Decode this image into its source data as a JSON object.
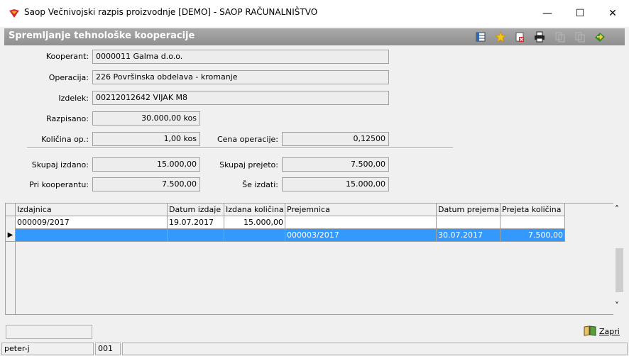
{
  "window": {
    "title": "Saop Večnivojski razpis proizvodnje [DEMO] - SAOP RAČUNALNIŠTVO",
    "minimize_glyph": "—",
    "maximize_glyph": "☐",
    "close_glyph": "✕"
  },
  "header": {
    "title": "Spremljanje tehnološke kooperacije",
    "toolbar_icons": [
      "columns-icon",
      "star-icon",
      "delete-doc-icon",
      "print-icon",
      "copy-disabled-icon",
      "copy2-disabled-icon",
      "exit-icon"
    ]
  },
  "form": {
    "kooperant_label": "Kooperant:",
    "kooperant_value": "0000011 Galma d.o.o.",
    "operacija_label": "Operacija:",
    "operacija_value": "226 Površinska obdelava - kromanje",
    "izdelek_label": "Izdelek:",
    "izdelek_value": "00212012642 VIJAK M8",
    "razpisano_label": "Razpisano:",
    "razpisano_value": "30.000,00 kos",
    "kolicina_op_label": "Količina op.:",
    "kolicina_op_value": "1,00 kos",
    "cena_operacije_label": "Cena operacije:",
    "cena_operacije_value": "0,12500",
    "skupaj_izdano_label": "Skupaj izdano:",
    "skupaj_izdano_value": "15.000,00",
    "skupaj_prejeto_label": "Skupaj prejeto:",
    "skupaj_prejeto_value": "7.500,00",
    "pri_kooperantu_label": "Pri kooperantu:",
    "pri_kooperantu_value": "7.500,00",
    "se_izdati_label": "Še izdati:",
    "se_izdati_value": "15.000,00"
  },
  "grid": {
    "headers": [
      "Izdajnica",
      "Datum izdaje",
      "Izdana količina",
      "Prejemnica",
      "Datum prejema",
      "Prejeta količina"
    ],
    "rows": [
      [
        "000009/2017",
        "19.07.2017",
        "15.000,00",
        "",
        "",
        ""
      ],
      [
        "",
        "",
        "",
        "000003/2017",
        "30.07.2017",
        "7.500,00"
      ]
    ],
    "row_indicator": "▶",
    "scroll_up": "˄",
    "scroll_down": "˅"
  },
  "footer": {
    "close_label": "Zapri"
  },
  "statusbar": {
    "user": "peter-j",
    "code": "001"
  },
  "colors": {
    "selection": "#3399ff",
    "header_band": "#9a9a9a"
  }
}
